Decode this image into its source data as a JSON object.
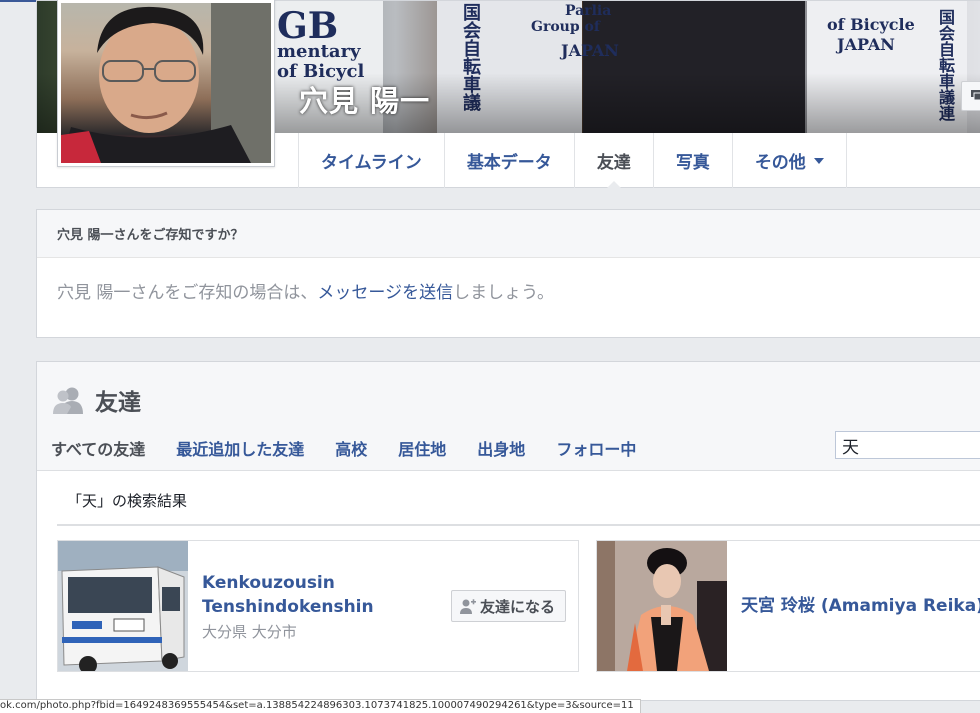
{
  "profile": {
    "name": "穴見 陽一",
    "cover_texts": [
      "GB",
      "mentary",
      "of Bicycl",
      "Parlia",
      "Group of",
      "JAPAN",
      "国会自転車議",
      "of Bicycle",
      "JAPAN",
      "国会自転車議連"
    ]
  },
  "tabs": [
    {
      "label": "タイムライン"
    },
    {
      "label": "基本データ"
    },
    {
      "label": "友達"
    },
    {
      "label": "写真"
    },
    {
      "label": "その他"
    }
  ],
  "know": {
    "heading": "穴見 陽一さんをご存知ですか？",
    "body_prefix": "穴見 陽一さんをご存知の場合は、",
    "body_link": "メッセージを送信",
    "body_suffix": "しましょう。"
  },
  "friends": {
    "title": "友達",
    "tabs": [
      "すべての友達",
      "最近追加した友達",
      "高校",
      "居住地",
      "出身地",
      "フォロー中"
    ],
    "search_value": "天",
    "results_label": "「天」の検索結果",
    "results": [
      {
        "name_line1": "Kenkouzousin",
        "name_line2": "Tenshindokenshin",
        "location": "大分県 大分市",
        "button": "友達になる"
      },
      {
        "name_line1": "天宮 玲桜 (Amamiya Reika)"
      }
    ]
  },
  "statusbar": {
    "url": "ok.com/photo.php?fbid=1649248369555454&set=a.138854224896303.1073741825.100007490294261&type=3&source=11"
  },
  "icons": {
    "friends": "friends-icon",
    "add_friend": "add-friend-icon",
    "message": "message-icon",
    "caret": "caret-down-icon"
  },
  "colors": {
    "link": "#365899",
    "text": "#1d2129",
    "muted": "#90949c",
    "background": "#e9ebee",
    "topline": "#3b5998"
  }
}
